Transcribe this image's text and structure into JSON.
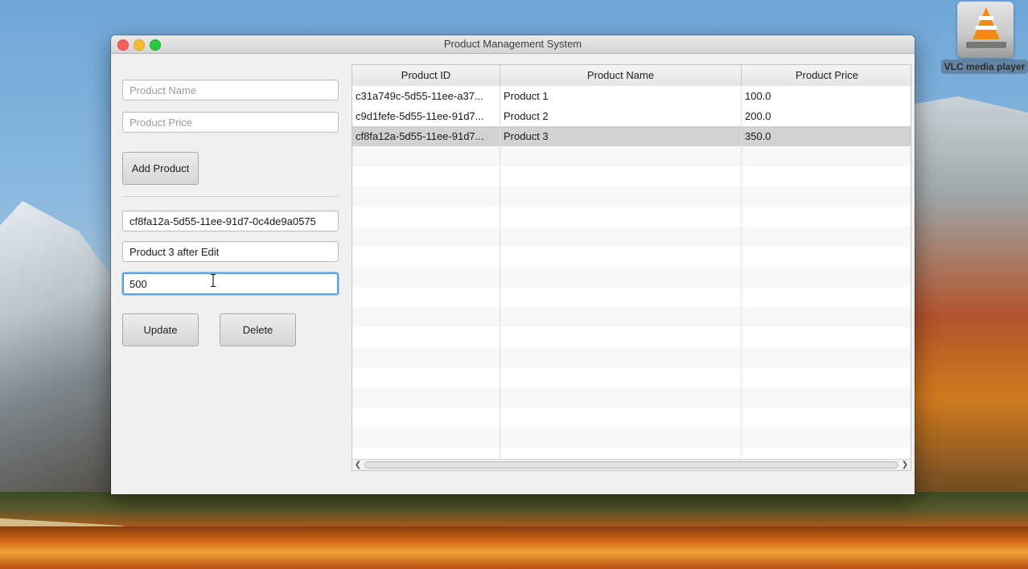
{
  "window": {
    "title": "Product Management System"
  },
  "desktop": {
    "vlc_label": "VLC media player"
  },
  "add_form": {
    "name_placeholder": "Product Name",
    "price_placeholder": "Product Price",
    "add_button": "Add Product"
  },
  "edit_form": {
    "id_value": "cf8fa12a-5d55-11ee-91d7-0c4de9a0575",
    "name_value": "Product 3 after Edit",
    "price_value": "500",
    "update_button": "Update",
    "delete_button": "Delete"
  },
  "table": {
    "columns": [
      "Product ID",
      "Product Name",
      "Product Price"
    ],
    "rows": [
      {
        "id": "c31a749c-5d55-11ee-a37...",
        "name": "Product 1",
        "price": "100.0"
      },
      {
        "id": "c9d1fefe-5d55-11ee-91d7...",
        "name": "Product 2",
        "price": "200.0"
      },
      {
        "id": "cf8fa12a-5d55-11ee-91d7...",
        "name": "Product 3",
        "price": "350.0"
      }
    ],
    "selected_row": 3
  }
}
